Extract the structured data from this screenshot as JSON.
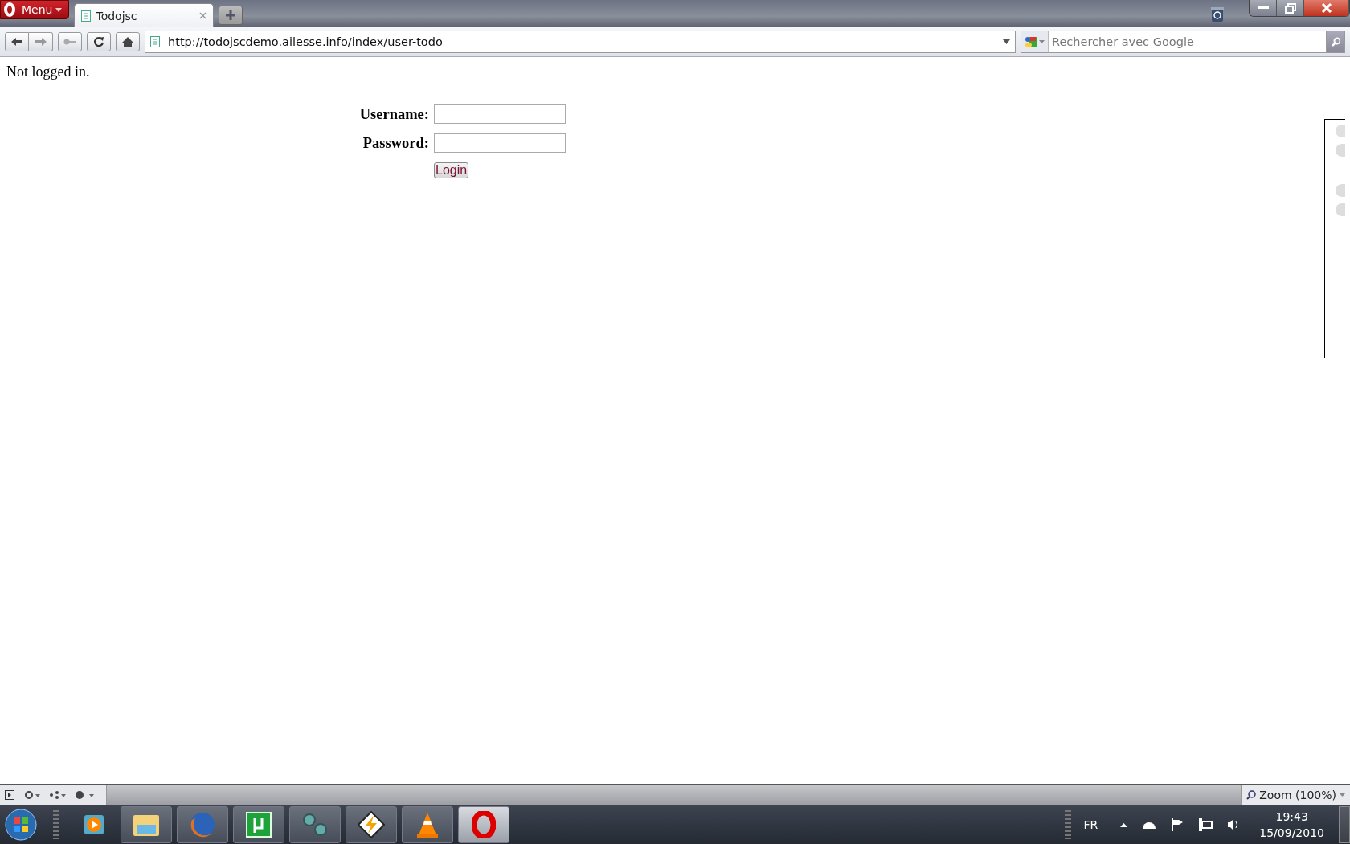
{
  "browser": {
    "menu_label": "Menu",
    "tabs": [
      {
        "title": "Todojsc",
        "selected": true
      }
    ],
    "address": "http://todojscdemo.ailesse.info/index/user-todo",
    "search_placeholder": "Rechercher avec Google"
  },
  "page": {
    "status_text": "Not logged in.",
    "fields": [
      {
        "label": "Username:"
      },
      {
        "label": "Password:"
      }
    ],
    "button": "Login"
  },
  "status_bar": {
    "zoom": "Zoom (100%)"
  },
  "taskbar": {
    "language": "FR",
    "time": "19:43",
    "date": "15/09/2010"
  }
}
